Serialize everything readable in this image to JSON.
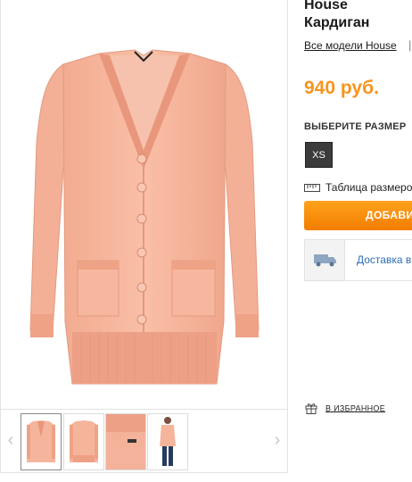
{
  "product": {
    "brand": "House",
    "type": "Кардиган",
    "all_models_link": "Все модели House",
    "separator": "|",
    "price": "940 руб."
  },
  "size": {
    "title": "ВЫБЕРИТЕ РАЗМЕР",
    "options": [
      "XS"
    ],
    "selected": "XS",
    "table_link": "Таблица размеров"
  },
  "actions": {
    "add_to_cart": "ДОБАВИТЬ В КОРЗИНУ",
    "delivery": "Доставка в",
    "favorites": "В ИЗБРАННОЕ"
  },
  "gallery": {
    "prev_arrow": "‹",
    "next_arrow": "›",
    "thumbnails": [
      "front",
      "back",
      "detail",
      "model"
    ],
    "active_thumbnail": 0
  },
  "colors": {
    "accent_orange": "#f7941d",
    "cardigan_peach": "#f7b79f",
    "link_blue": "#2e6fb5"
  },
  "icons": {
    "ruler": "ruler-icon",
    "truck": "truck-icon",
    "gift": "gift-icon"
  }
}
